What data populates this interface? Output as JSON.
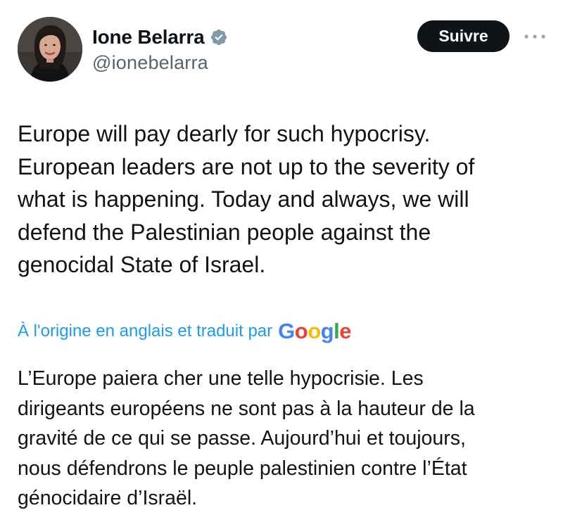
{
  "header": {
    "display_name": "Ione Belarra",
    "handle": "@ionebelarra",
    "follow_label": "Suivre",
    "verified_icon": "verified-badge-icon",
    "more_icon": "more-horizontal-icon"
  },
  "tweet": {
    "text": "Europe will pay dearly for such hypocrisy.\nEuropean leaders are not up to the severity of\nwhat is happening. Today and always, we will\ndefend the Palestinian people against the\ngenocidal State of Israel."
  },
  "translation": {
    "label": "À l'origine en anglais et traduit par",
    "provider_letters": [
      "G",
      "o",
      "o",
      "g",
      "l",
      "e"
    ],
    "provider_colors": [
      "#4285F4",
      "#EA4335",
      "#FBBC05",
      "#4285F4",
      "#34A853",
      "#EA4335"
    ],
    "text": "L’Europe paiera cher une telle hypocrisie. Les\ndirigeants européens ne sont pas à la hauteur de la\ngravité de ce qui se passe. Aujourd’hui et toujours,\nnous défendrons le peuple palestinien contre l’État\ngénocidaire d’Israël."
  },
  "colors": {
    "text": "#0f1419",
    "secondary": "#536471",
    "link": "#1d9bf0",
    "verified_badge": "#829aab",
    "button_bg": "#0f1419"
  }
}
